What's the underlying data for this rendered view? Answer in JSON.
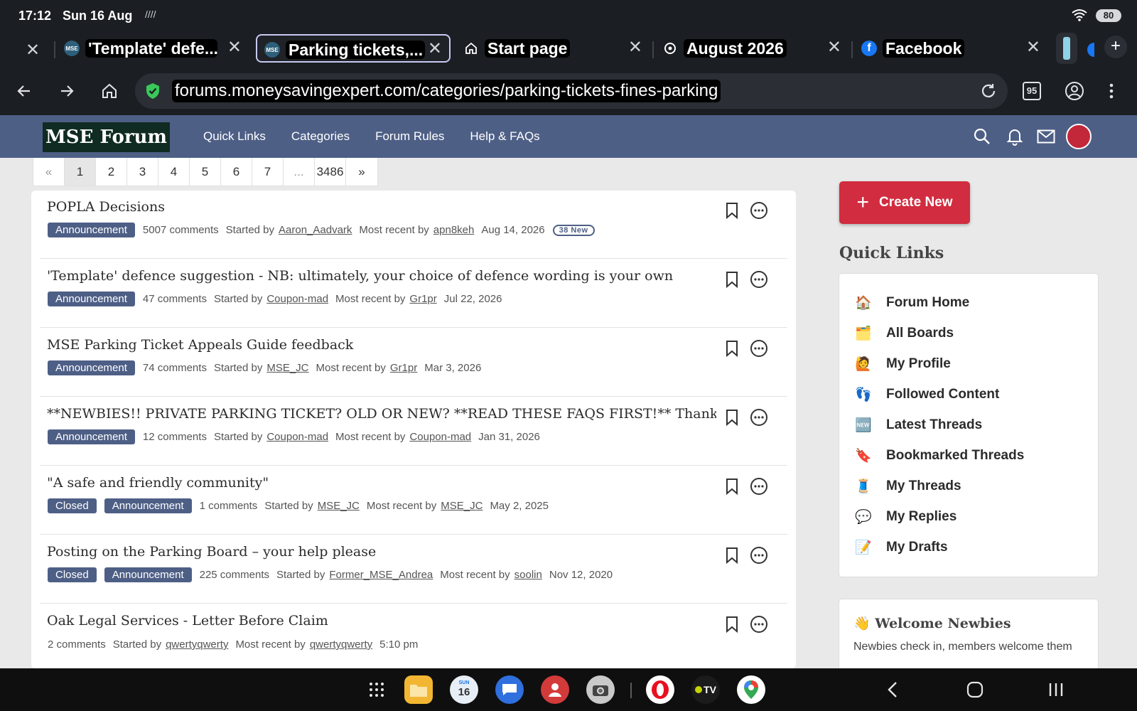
{
  "status_bar": {
    "time": "17:12",
    "date": "Sun 16 Aug",
    "glyph": "////",
    "battery": "80"
  },
  "browser": {
    "tabs": [
      {
        "title": "'Template' defe...",
        "favicon": "mse-favicon",
        "favicon_text": "MSE",
        "active": false
      },
      {
        "title": "Parking tickets,...",
        "favicon": "mse-favicon",
        "favicon_text": "MSE",
        "active": true
      },
      {
        "title": "Start page",
        "favicon": "home-icon",
        "active": false
      },
      {
        "title": "August 2026",
        "favicon": "sync-icon",
        "active": false
      },
      {
        "title": "Facebook",
        "favicon": "facebook-icon",
        "favicon_text": "f",
        "active": false
      }
    ],
    "url": "forums.moneysavingexpert.com/categories/parking-tickets-fines-parking",
    "tab_count": "95"
  },
  "site": {
    "logo": "MSE Forum",
    "nav": [
      "Quick Links",
      "Categories",
      "Forum Rules",
      "Help & FAQs"
    ],
    "brand_color": "#4e5f86",
    "accent_color": "#d12c3f"
  },
  "pagination": [
    "«",
    "1",
    "2",
    "3",
    "4",
    "5",
    "6",
    "7",
    "...",
    "3486",
    "»"
  ],
  "threads": [
    {
      "title": "POPLA Decisions",
      "tags": [
        "Announcement"
      ],
      "comments": "5007 comments",
      "started_by_label": "Started by",
      "author": "Aaron_Aadvark",
      "recent_label": "Most recent by",
      "recent_user": "apn8keh",
      "date": "Aug 14, 2026",
      "badge": "38 New"
    },
    {
      "title": "'Template' defence suggestion - NB: ultimately, your choice of defence wording is your own",
      "tags": [
        "Announcement"
      ],
      "comments": "47 comments",
      "started_by_label": "Started by",
      "author": "Coupon-mad",
      "recent_label": "Most recent by",
      "recent_user": "Gr1pr",
      "date": "Jul 22, 2026"
    },
    {
      "title": "MSE Parking Ticket Appeals Guide feedback",
      "tags": [
        "Announcement"
      ],
      "comments": "74 comments",
      "started_by_label": "Started by",
      "author": "MSE_JC",
      "recent_label": "Most recent by",
      "recent_user": "Gr1pr",
      "date": "Mar 3, 2026"
    },
    {
      "title": "**NEWBIES!! PRIVATE PARKING TICKET? OLD OR NEW? **READ THESE FAQS FIRST!** Thankyou!",
      "tags": [
        "Announcement"
      ],
      "comments": "12 comments",
      "started_by_label": "Started by",
      "author": "Coupon-mad",
      "recent_label": "Most recent by",
      "recent_user": "Coupon-mad",
      "date": "Jan 31, 2026"
    },
    {
      "title": "\"A safe and friendly community\"",
      "tags": [
        "Closed",
        "Announcement"
      ],
      "comments": "1 comments",
      "started_by_label": "Started by",
      "author": "MSE_JC",
      "recent_label": "Most recent by",
      "recent_user": "MSE_JC",
      "date": "May 2, 2025"
    },
    {
      "title": "Posting on the Parking Board – your help please",
      "tags": [
        "Closed",
        "Announcement"
      ],
      "comments": "225 comments",
      "started_by_label": "Started by",
      "author": "Former_MSE_Andrea",
      "recent_label": "Most recent by",
      "recent_user": "soolin",
      "date": "Nov 12, 2020"
    },
    {
      "title": "Oak Legal Services - Letter Before Claim",
      "tags": [],
      "comments": "2 comments",
      "started_by_label": "Started by",
      "author": "qwertyqwerty",
      "recent_label": "Most recent by",
      "recent_user": "qwertyqwerty",
      "date": "5:10 pm"
    }
  ],
  "sidebar": {
    "create_label": "Create New",
    "quick_links_heading": "Quick Links",
    "quick_links": [
      {
        "emoji": "🏠",
        "icon": "house-icon",
        "label": "Forum Home"
      },
      {
        "emoji": "🗂️",
        "icon": "folders-icon",
        "label": "All Boards"
      },
      {
        "emoji": "🙋",
        "icon": "person-icon",
        "label": "My Profile"
      },
      {
        "emoji": "👣",
        "icon": "footprints-icon",
        "label": "Followed Content"
      },
      {
        "emoji": "🆕",
        "icon": "new-icon",
        "label": "Latest Threads"
      },
      {
        "emoji": "🔖",
        "icon": "bookmark-icon",
        "label": "Bookmarked Threads"
      },
      {
        "emoji": "🧵",
        "icon": "thread-spool-icon",
        "label": "My Threads"
      },
      {
        "emoji": "💬",
        "icon": "speech-bubble-icon",
        "label": "My Replies"
      },
      {
        "emoji": "📝",
        "icon": "memo-icon",
        "label": "My Drafts"
      }
    ],
    "welcome": {
      "emoji": "👋",
      "title": "Welcome Newbies",
      "text": "Newbies check in, members welcome them"
    }
  },
  "dock": {
    "apps": [
      {
        "name": "app-drawer-icon"
      },
      {
        "name": "files-app-icon"
      },
      {
        "name": "calendar-app-icon",
        "label_top": "SUN",
        "label": "16"
      },
      {
        "name": "messages-app-icon"
      },
      {
        "name": "contacts-app-icon"
      },
      {
        "name": "camera-app-icon"
      },
      {
        "name": "opera-app-icon"
      },
      {
        "name": "ee-tv-app-icon",
        "label": "TV"
      },
      {
        "name": "maps-app-icon"
      }
    ]
  }
}
